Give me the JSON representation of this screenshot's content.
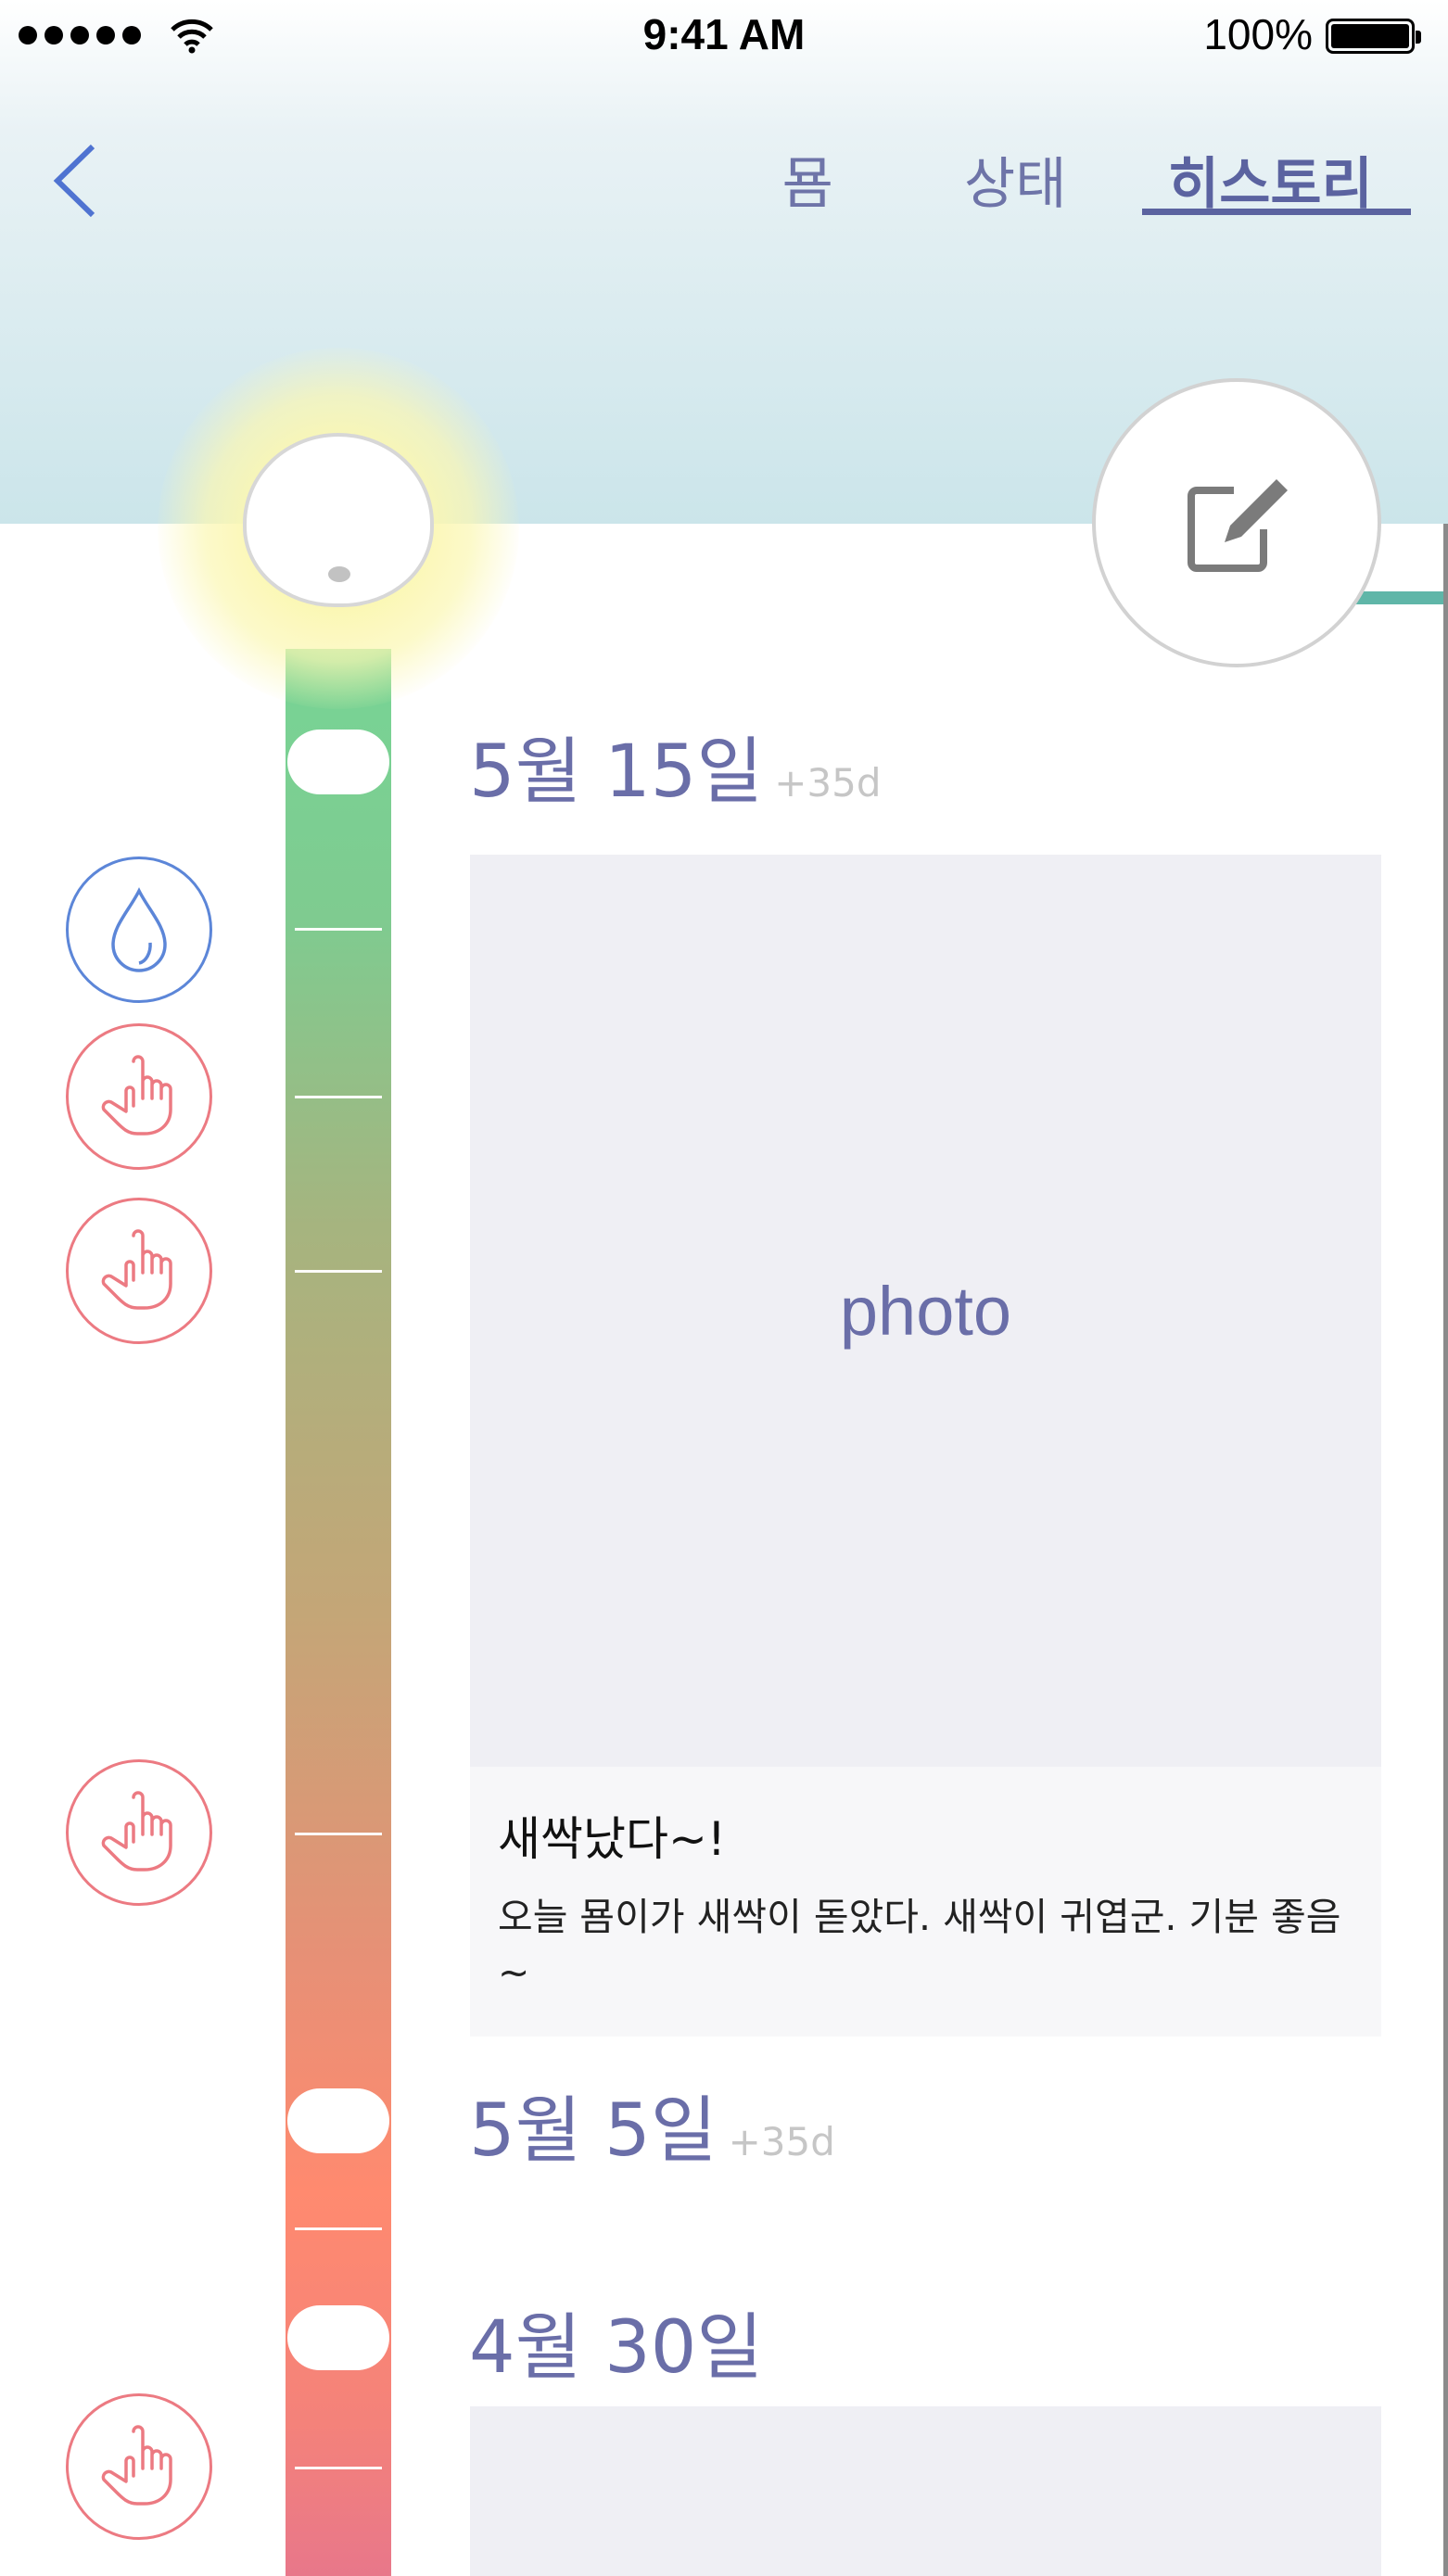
{
  "status_bar": {
    "time": "9:41 AM",
    "battery": "100%"
  },
  "nav": {
    "tabs": [
      {
        "label": "묨"
      },
      {
        "label": "상태"
      },
      {
        "label": "히스토리"
      }
    ],
    "active_tab": "히스토리"
  },
  "entries": [
    {
      "date": "5월 15일",
      "delta": "+35d",
      "photo_label": "photo",
      "title": "새싹났다~!",
      "body": "오늘 묨이가 새싹이 돋았다. 새싹이 귀엽군. 기분 좋음~"
    },
    {
      "date": "5월 5일",
      "delta": "+35d"
    },
    {
      "date": "4월 30일"
    }
  ],
  "events": [
    {
      "type": "water",
      "icon": "water-drop-icon"
    },
    {
      "type": "touch",
      "icon": "hand-pointer-icon"
    },
    {
      "type": "touch",
      "icon": "hand-pointer-icon"
    },
    {
      "type": "touch",
      "icon": "hand-pointer-icon"
    },
    {
      "type": "touch",
      "icon": "hand-pointer-icon"
    }
  ],
  "colors": {
    "accent": "#6a6ea8",
    "water": "#5c86d8",
    "touch": "#ec7a82",
    "edit_indicator": "#5fb6a8"
  }
}
